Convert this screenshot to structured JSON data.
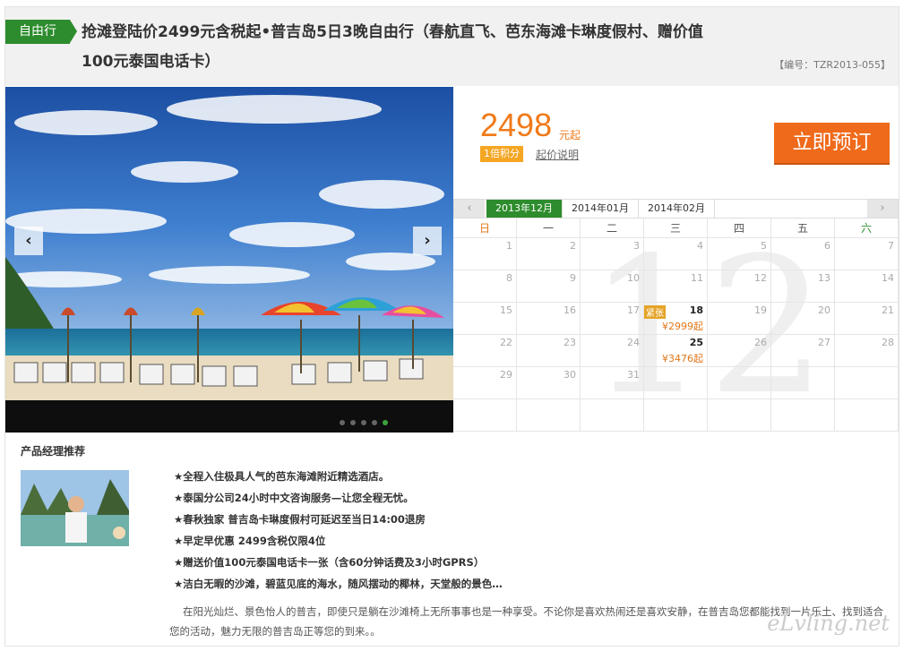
{
  "header": {
    "tag": "自由行",
    "title": "抢滩登陆价2499元含税起•普吉岛5日3晚自由行（春航直飞、芭东海滩卡琳度假村、赠价值100元泰国电话卡）",
    "code": "【编号：TZR2013-055】"
  },
  "carousel": {
    "prev": "‹",
    "next": "›",
    "dots": 5,
    "active_dot": 4
  },
  "price": {
    "amount": "2498",
    "unit": "元起",
    "points_badge": "1倍积分",
    "explain_link": "起价说明",
    "book_button": "立即预订"
  },
  "calendar": {
    "prev_arrow": "‹",
    "next_arrow": "›",
    "months": [
      "2013年12月",
      "2014年01月",
      "2014年02月"
    ],
    "active_month": 0,
    "big_month": "12",
    "weekdays": [
      "日",
      "一",
      "二",
      "三",
      "四",
      "五",
      "六"
    ],
    "weeks": [
      [
        {
          "d": "1"
        },
        {
          "d": "2"
        },
        {
          "d": "3"
        },
        {
          "d": "4"
        },
        {
          "d": "5"
        },
        {
          "d": "6"
        },
        {
          "d": "7"
        }
      ],
      [
        {
          "d": "8"
        },
        {
          "d": "9"
        },
        {
          "d": "10"
        },
        {
          "d": "11"
        },
        {
          "d": "12"
        },
        {
          "d": "13"
        },
        {
          "d": "14"
        }
      ],
      [
        {
          "d": "15"
        },
        {
          "d": "16"
        },
        {
          "d": "17"
        },
        {
          "d": "18",
          "price": "¥2999起",
          "tag": "紧张"
        },
        {
          "d": "19"
        },
        {
          "d": "20"
        },
        {
          "d": "21"
        }
      ],
      [
        {
          "d": "22"
        },
        {
          "d": "23"
        },
        {
          "d": "24"
        },
        {
          "d": "25",
          "price": "¥3476起"
        },
        {
          "d": "26"
        },
        {
          "d": "27"
        },
        {
          "d": "28"
        }
      ],
      [
        {
          "d": "29"
        },
        {
          "d": "30"
        },
        {
          "d": "31"
        },
        {
          "d": ""
        },
        {
          "d": ""
        },
        {
          "d": ""
        },
        {
          "d": ""
        }
      ],
      [
        {
          "d": ""
        },
        {
          "d": ""
        },
        {
          "d": ""
        },
        {
          "d": ""
        },
        {
          "d": ""
        },
        {
          "d": ""
        },
        {
          "d": ""
        }
      ]
    ]
  },
  "recommend": {
    "title": "产品经理推荐",
    "items": [
      "★全程入住极具人气的芭东海滩附近精选酒店。",
      "★泰国分公司24小时中文咨询服务—让您全程无忧。",
      "★春秋独家 普吉岛卡琳度假村可延迟至当日14:00退房",
      "★早定早优惠 2499含税仅限4位",
      "★赠送价值100元泰国电话卡一张（含60分钟话费及3小时GPRS）",
      "★洁白无暇的沙滩，碧蓝见底的海水，随风摆动的椰林，天堂般的景色…"
    ],
    "paragraph": "在阳光灿烂、景色怡人的普吉，即使只是躺在沙滩椅上无所事事也是一种享受。不论你是喜欢热闹还是喜欢安静，在普吉岛您都能找到一片乐土、找到适合您的活动，魅力无限的普吉岛正等您的到来。。",
    "watermark": "eLvling.net"
  },
  "colors": {
    "green": "#2d8c2d",
    "orange": "#f07a19",
    "button": "#ef6a1a"
  }
}
